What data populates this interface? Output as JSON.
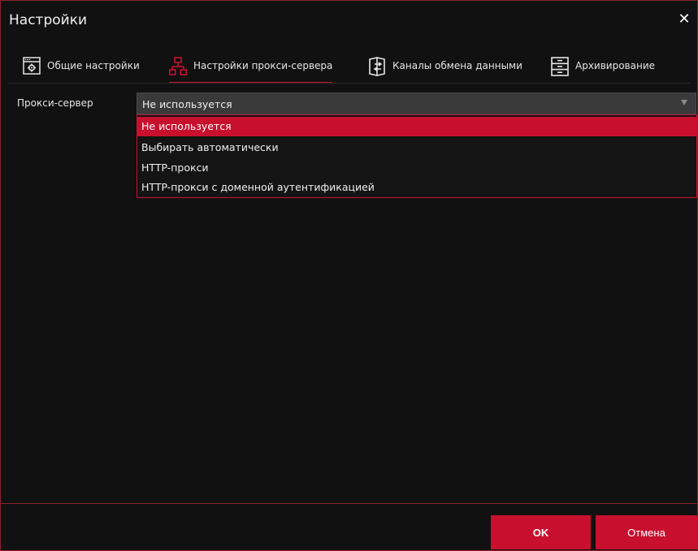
{
  "window": {
    "title": "Настройки"
  },
  "tabs": [
    {
      "label": "Общие настройки",
      "icon": "settings-window-icon",
      "active": false
    },
    {
      "label": "Настройки прокси-сервера",
      "icon": "network-icon",
      "active": true
    },
    {
      "label": "Каналы обмена данными",
      "icon": "data-exchange-icon",
      "active": false
    },
    {
      "label": "Архивирование",
      "icon": "archive-icon",
      "active": false
    }
  ],
  "proxy": {
    "label": "Прокси-сервер",
    "selected_value": "Не используется",
    "options": [
      "Не используется",
      "Выбирать автоматически",
      "HTTP-прокси",
      "HTTP-прокси с доменной аутентификацией"
    ]
  },
  "footer": {
    "ok_label": "OK",
    "cancel_label": "Отмена"
  },
  "colors": {
    "accent": "#c8102e",
    "background": "#111111",
    "border": "#8a1f2d"
  }
}
